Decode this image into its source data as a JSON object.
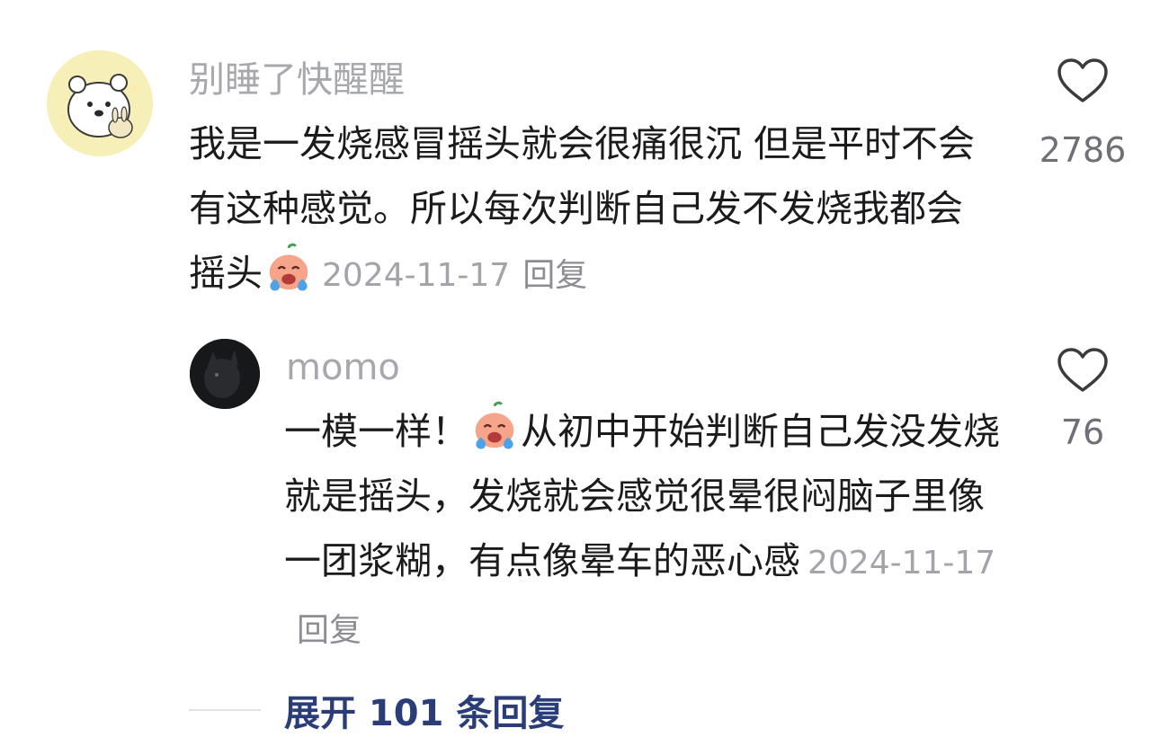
{
  "comments": [
    {
      "username": "别睡了快醒醒",
      "text": "我是一发烧感冒摇头就会很痛很沉 但是平时不会有这种感觉。所以每次判断自己发不发烧我都会摇头",
      "emoji": "crying-face-emoji",
      "date": "2024-11-17",
      "reply_label": "回复",
      "likes": "2786",
      "avatar": "bear-avatar"
    },
    {
      "username": "momo",
      "text_before_emoji": "一模一样！",
      "emoji": "crying-face-emoji",
      "text_after_emoji": "从初中开始判断自己发没发烧就是摇头，发烧就会感觉很晕很闷脑子里像一团浆糊，有点像晕车的恶心感",
      "date": "2024-11-17",
      "reply_label": "回复",
      "likes": "76",
      "avatar": "dark-avatar"
    }
  ],
  "expand_replies": "展开 101 条回复",
  "colors": {
    "username": "#a7a8ad",
    "text": "#1b1b1e",
    "meta": "#a3a4a9",
    "expand": "#2b3d78"
  },
  "icons": {
    "like": "heart-outline-icon"
  }
}
